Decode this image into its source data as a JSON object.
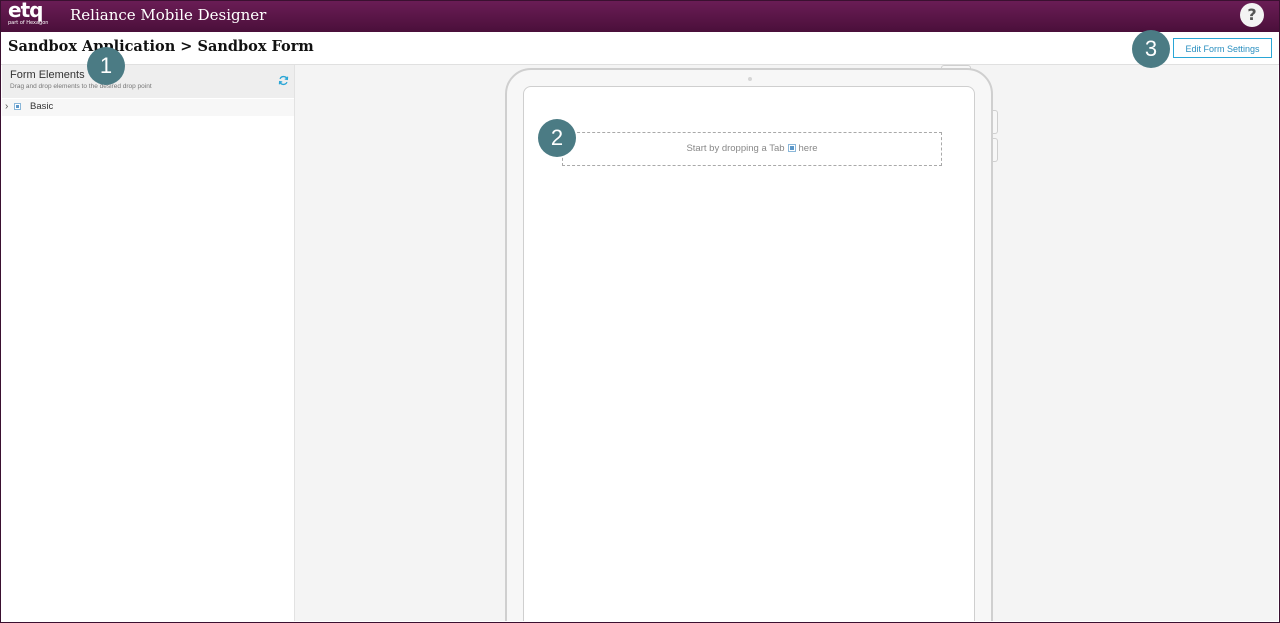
{
  "topbar": {
    "logo_text": "etq",
    "logo_sub": "part of Hexagon",
    "app_title": "Reliance Mobile Designer",
    "help_label": "?"
  },
  "header": {
    "breadcrumb": "Sandbox Application > Sandbox Form",
    "edit_settings_label": "Edit Form Settings"
  },
  "sidebar": {
    "title": "Form Elements",
    "subtitle": "Drag and drop elements to the desired drop point",
    "refresh_icon": "refresh-icon",
    "items": [
      {
        "label": "Basic",
        "icon": "basic-element-icon"
      }
    ]
  },
  "canvas": {
    "dropzone_prefix": "Start by dropping a Tab",
    "dropzone_suffix": "here",
    "dropzone_icon": "tab-icon"
  },
  "callouts": [
    "1",
    "2",
    "3"
  ],
  "colors": {
    "topbar": "#5c1648",
    "accent": "#2aa6d6",
    "callout": "#4b7b84"
  }
}
